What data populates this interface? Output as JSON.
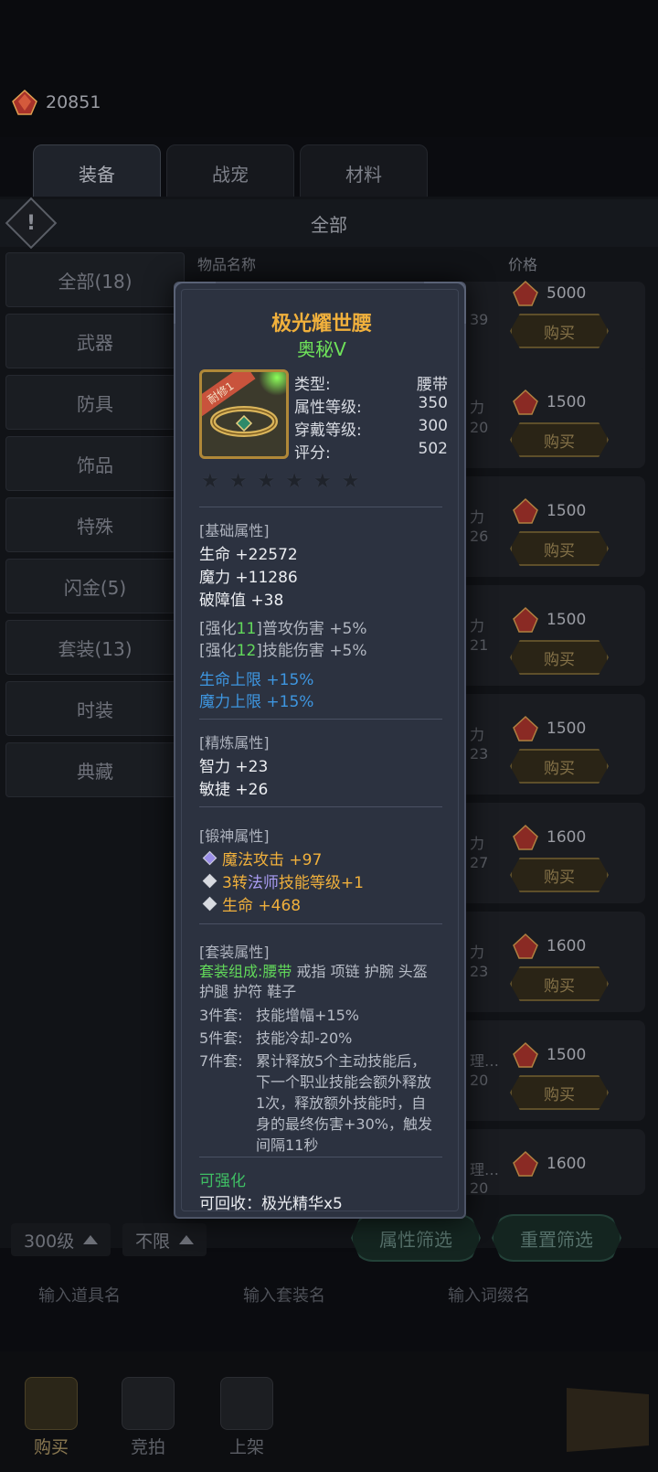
{
  "currency": {
    "amount": "20851"
  },
  "tabs": [
    "装备",
    "战宠",
    "材料"
  ],
  "filter_title": "全部",
  "categories": [
    "全部(18)",
    "武器",
    "防具",
    "饰品",
    "特殊",
    "闪金(5)",
    "套装(13)",
    "时装",
    "典藏"
  ],
  "columns": {
    "name": "物品名称",
    "price": "价格"
  },
  "listing": [
    {
      "frag1": "",
      "frag2": "39",
      "price": "5000"
    },
    {
      "frag1": "力",
      "frag2": "20",
      "price": "1500"
    },
    {
      "frag1": "力",
      "frag2": "26",
      "price": "1500"
    },
    {
      "frag1": "力",
      "frag2": "21",
      "price": "1500"
    },
    {
      "frag1": "力",
      "frag2": "23",
      "price": "1500"
    },
    {
      "frag1": "力",
      "frag2": "27",
      "price": "1600"
    },
    {
      "frag1": "力",
      "frag2": "23",
      "price": "1600"
    },
    {
      "frag1": "理…",
      "frag2": "20",
      "price": "1500"
    },
    {
      "frag1": "理…",
      "frag2": "20",
      "price": "1600"
    }
  ],
  "buy_label": "购买",
  "bottom_filter": {
    "level": "300级",
    "limit": "不限",
    "attr_filter": "属性筛选",
    "reset_filter": "重置筛选"
  },
  "search": {
    "item": "输入道具名",
    "set": "输入套装名",
    "affix": "输入词缀名"
  },
  "nav": {
    "buy": "购买",
    "auction": "竞拍",
    "list": "上架"
  },
  "tooltip": {
    "name": "极光耀世腰",
    "grade": "奥秘Ⅴ",
    "ribbon": "耐修1",
    "stats": [
      {
        "k": "类型:",
        "v": "腰带"
      },
      {
        "k": "属性等级:",
        "v": "350"
      },
      {
        "k": "穿戴等级:",
        "v": "300"
      },
      {
        "k": "评分:",
        "v": "502"
      }
    ],
    "base_title": "[基础属性]",
    "base": [
      "生命 +22572",
      "魔力 +11286",
      "破障值 +38"
    ],
    "enhance": [
      {
        "pre": "[强化",
        "num": "11",
        "post": "]普攻伤害 +5%"
      },
      {
        "pre": "[强化",
        "num": "12",
        "post": "]技能伤害 +5%"
      }
    ],
    "blue": [
      "生命上限 +15%",
      "魔力上限 +15%"
    ],
    "refine_title": "[精炼属性]",
    "refine": [
      "智力 +23",
      "敏捷 +26"
    ],
    "forge_title": "[锻神属性]",
    "forge": {
      "l1": "魔法攻击 +97",
      "l2a": "3转",
      "l2b": "法师",
      "l2c": "技能等级+1",
      "l3": "生命 +468"
    },
    "set_title": "[套装属性]",
    "set_comp_label": "套装组成:",
    "set_comp_active": "腰带",
    "set_comp_rest": "戒指 项链 护腕 头盔 护腿 护符 鞋子",
    "set_bonus": [
      {
        "k": "3件套:",
        "v": "技能增幅+15%"
      },
      {
        "k": "5件套:",
        "v": "技能冷却-20%"
      },
      {
        "k": "7件套:",
        "v": "累计释放5个主动技能后，下一个职业技能会额外释放1次，释放额外技能时，自身的最终伤害+30%，触发间隔11秒"
      }
    ],
    "can_upgrade": "可强化",
    "recycle": "可回收：极光精华x5"
  },
  "colors": {
    "legendary": "#f0b03c",
    "grade": "#6fe35a",
    "blue": "#3e96e0",
    "green": "#3fbf64"
  }
}
